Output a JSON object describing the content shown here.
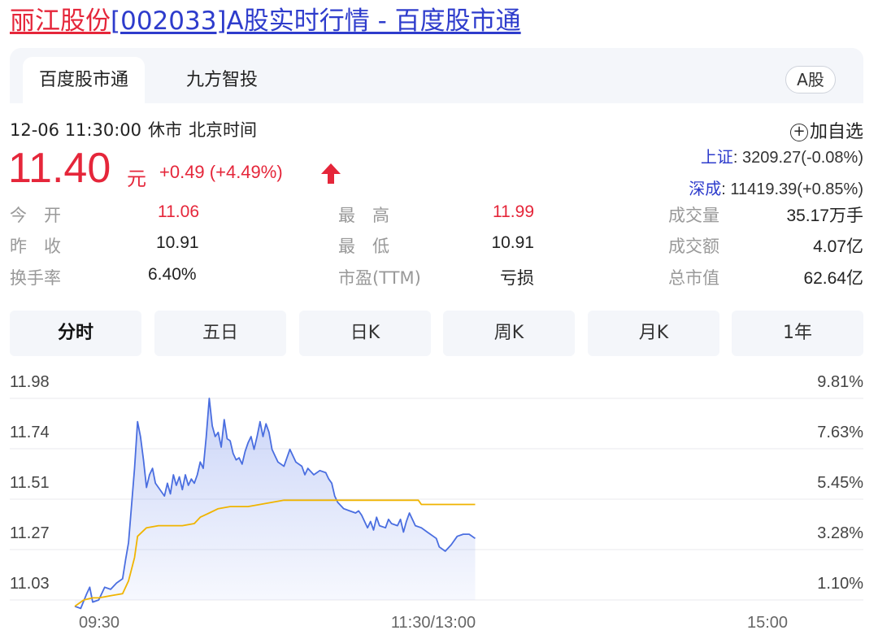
{
  "header": {
    "title_name": "丽江股份",
    "title_rest": "[002033]A股实时行情 - 百度股市通"
  },
  "tabs": [
    {
      "label": "百度股市通",
      "active": true
    },
    {
      "label": "九方智投",
      "active": false
    }
  ],
  "badge": "A股",
  "status": {
    "datetime": "12-06 11:30:00",
    "market_state": "休市",
    "timezone": "北京时间"
  },
  "watch": {
    "label": "加自选"
  },
  "price": {
    "current": "11.40",
    "unit": "元",
    "change": "+0.49 (+4.49%)",
    "color": "#e5263a"
  },
  "indices": [
    {
      "name": "上证",
      "value": ": 3209.27(-0.08%)"
    },
    {
      "name": "深成",
      "value": ": 11419.39(+0.85%)"
    }
  ],
  "stats": [
    {
      "label": "今　开",
      "value": "11.06",
      "red": true
    },
    {
      "label": "昨　收",
      "value": "10.91",
      "red": false
    },
    {
      "label": "换手率",
      "value": "6.40%",
      "red": false
    },
    {
      "label": "最　高",
      "value": "11.99",
      "red": true
    },
    {
      "label": "最　低",
      "value": "10.91",
      "red": false
    },
    {
      "label": "市盈(TTM)",
      "value": "亏损",
      "red": false
    },
    {
      "label": "成交量",
      "value": "35.17万手",
      "red": false
    },
    {
      "label": "成交额",
      "value": "4.07亿",
      "red": false
    },
    {
      "label": "总市值",
      "value": "62.64亿",
      "red": false
    }
  ],
  "periods": [
    {
      "label": "分时",
      "active": true
    },
    {
      "label": "五日",
      "active": false
    },
    {
      "label": "日K",
      "active": false
    },
    {
      "label": "周K",
      "active": false
    },
    {
      "label": "月K",
      "active": false
    },
    {
      "label": "1年",
      "active": false
    }
  ],
  "chart_data": {
    "type": "line",
    "ylim": [
      11.03,
      11.98
    ],
    "y_ticks_left": [
      "11.98",
      "11.74",
      "11.51",
      "11.27",
      "11.03"
    ],
    "y_ticks_right": [
      "9.81%",
      "7.63%",
      "5.45%",
      "3.28%",
      "1.10%"
    ],
    "x_ticks": [
      "09:30",
      "11:30/13:00",
      "15:00"
    ],
    "total_minutes": 240,
    "series": [
      {
        "color": "#4a6ee0",
        "fill": true,
        "points": [
          [
            0,
            11.0
          ],
          [
            2,
            10.99
          ],
          [
            4,
            11.06
          ],
          [
            5,
            11.09
          ],
          [
            6,
            11.02
          ],
          [
            8,
            11.03
          ],
          [
            10,
            11.09
          ],
          [
            12,
            11.08
          ],
          [
            14,
            11.11
          ],
          [
            16,
            11.13
          ],
          [
            17,
            11.22
          ],
          [
            18,
            11.3
          ],
          [
            20,
            11.65
          ],
          [
            21,
            11.87
          ],
          [
            22,
            11.8
          ],
          [
            23,
            11.69
          ],
          [
            24,
            11.56
          ],
          [
            25,
            11.62
          ],
          [
            26,
            11.65
          ],
          [
            27,
            11.58
          ],
          [
            28,
            11.56
          ],
          [
            30,
            11.52
          ],
          [
            31,
            11.58
          ],
          [
            32,
            11.53
          ],
          [
            33,
            11.62
          ],
          [
            34,
            11.57
          ],
          [
            35,
            11.61
          ],
          [
            36,
            11.55
          ],
          [
            37,
            11.62
          ],
          [
            38,
            11.57
          ],
          [
            39,
            11.6
          ],
          [
            40,
            11.58
          ],
          [
            41,
            11.62
          ],
          [
            42,
            11.68
          ],
          [
            43,
            11.65
          ],
          [
            44,
            11.8
          ],
          [
            45,
            11.98
          ],
          [
            46,
            11.85
          ],
          [
            47,
            11.8
          ],
          [
            48,
            11.82
          ],
          [
            49,
            11.75
          ],
          [
            50,
            11.88
          ],
          [
            51,
            11.79
          ],
          [
            52,
            11.78
          ],
          [
            53,
            11.72
          ],
          [
            54,
            11.69
          ],
          [
            55,
            11.7
          ],
          [
            56,
            11.67
          ],
          [
            57,
            11.73
          ],
          [
            58,
            11.77
          ],
          [
            59,
            11.8
          ],
          [
            60,
            11.74
          ],
          [
            61,
            11.8
          ],
          [
            62,
            11.87
          ],
          [
            63,
            11.8
          ],
          [
            64,
            11.86
          ],
          [
            65,
            11.82
          ],
          [
            66,
            11.74
          ],
          [
            67,
            11.71
          ],
          [
            68,
            11.68
          ],
          [
            70,
            11.66
          ],
          [
            72,
            11.74
          ],
          [
            74,
            11.68
          ],
          [
            76,
            11.66
          ],
          [
            77,
            11.62
          ],
          [
            78,
            11.65
          ],
          [
            80,
            11.62
          ],
          [
            82,
            11.64
          ],
          [
            84,
            11.63
          ],
          [
            85,
            11.6
          ],
          [
            86,
            11.58
          ],
          [
            87,
            11.52
          ],
          [
            88,
            11.49
          ],
          [
            90,
            11.46
          ],
          [
            92,
            11.45
          ],
          [
            94,
            11.44
          ],
          [
            95,
            11.45
          ],
          [
            96,
            11.43
          ],
          [
            98,
            11.37
          ],
          [
            99,
            11.4
          ],
          [
            100,
            11.36
          ],
          [
            101,
            11.42
          ],
          [
            102,
            11.38
          ],
          [
            104,
            11.37
          ],
          [
            105,
            11.41
          ],
          [
            106,
            11.39
          ],
          [
            108,
            11.38
          ],
          [
            109,
            11.41
          ],
          [
            110,
            11.35
          ],
          [
            111,
            11.4
          ],
          [
            112,
            11.44
          ],
          [
            114,
            11.38
          ],
          [
            116,
            11.37
          ],
          [
            118,
            11.35
          ],
          [
            120,
            11.33
          ],
          [
            121,
            11.32
          ],
          [
            122,
            11.28
          ],
          [
            124,
            11.26
          ],
          [
            126,
            11.29
          ],
          [
            128,
            11.33
          ],
          [
            130,
            11.34
          ],
          [
            132,
            11.34
          ],
          [
            134,
            11.32
          ]
        ]
      },
      {
        "color": "#f0b400",
        "fill": false,
        "points": [
          [
            0,
            11.0
          ],
          [
            3,
            11.03
          ],
          [
            6,
            11.04
          ],
          [
            8,
            11.04
          ],
          [
            12,
            11.05
          ],
          [
            16,
            11.06
          ],
          [
            18,
            11.12
          ],
          [
            20,
            11.23
          ],
          [
            21,
            11.33
          ],
          [
            24,
            11.37
          ],
          [
            28,
            11.38
          ],
          [
            32,
            11.38
          ],
          [
            36,
            11.38
          ],
          [
            40,
            11.39
          ],
          [
            42,
            11.42
          ],
          [
            45,
            11.44
          ],
          [
            48,
            11.46
          ],
          [
            52,
            11.47
          ],
          [
            58,
            11.47
          ],
          [
            62,
            11.48
          ],
          [
            66,
            11.49
          ],
          [
            70,
            11.5
          ],
          [
            80,
            11.5
          ],
          [
            90,
            11.5
          ],
          [
            100,
            11.5
          ],
          [
            115,
            11.5
          ],
          [
            116,
            11.48
          ],
          [
            120,
            11.48
          ],
          [
            134,
            11.48
          ]
        ]
      }
    ]
  }
}
